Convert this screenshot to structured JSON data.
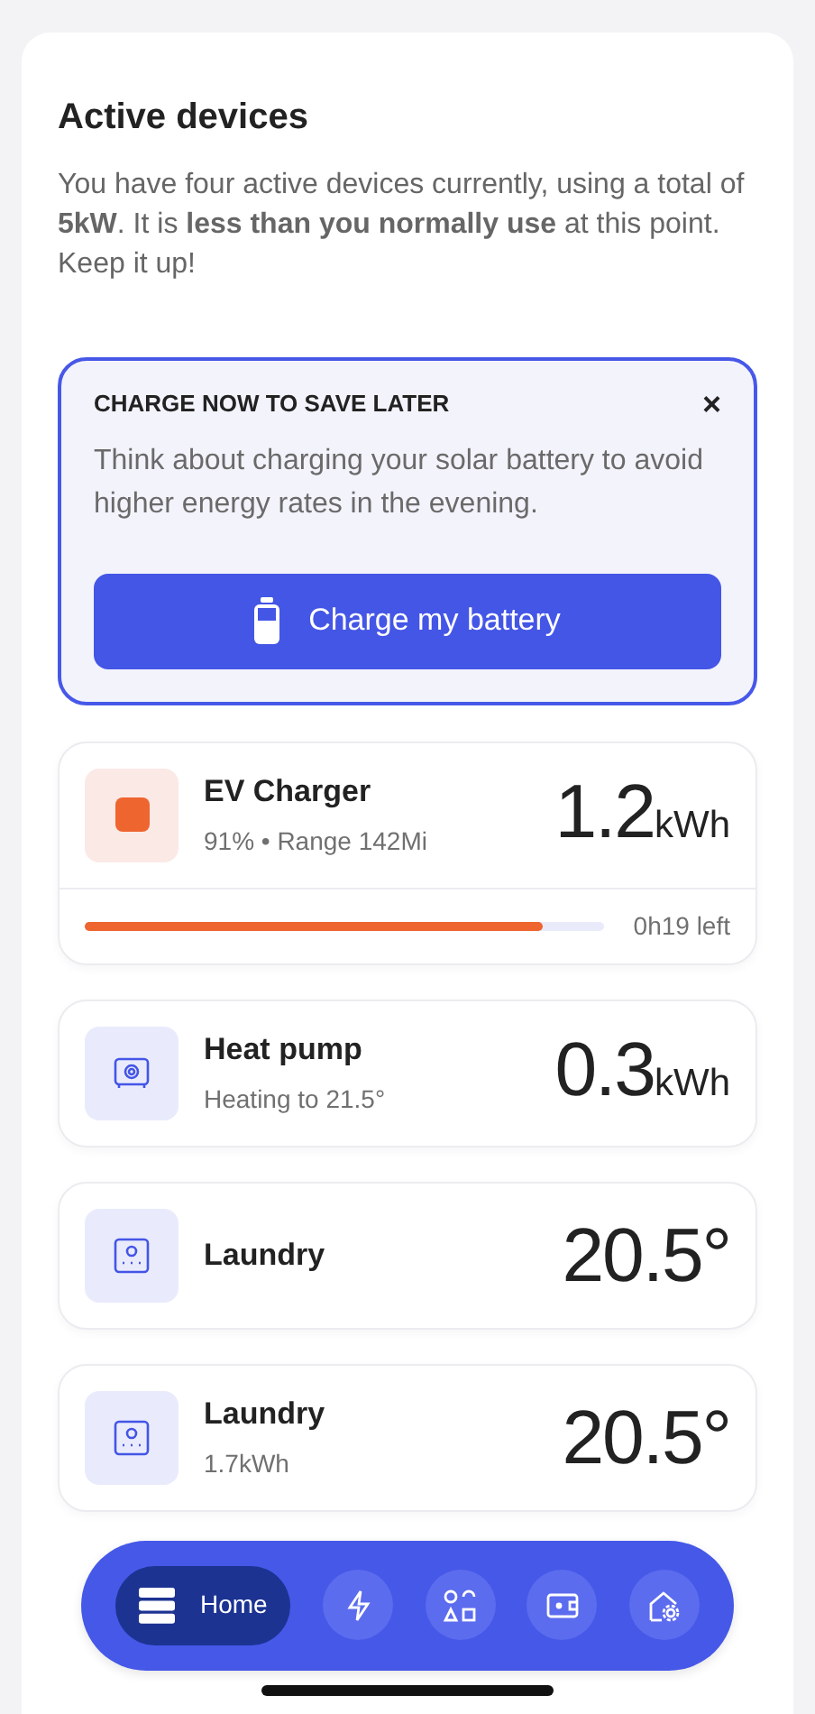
{
  "heading": "Active devices",
  "summary": "You have four active devices currently, using a total of **5kW**. It is **less than you normally use** at this point. Keep it up!",
  "banner": {
    "title": "CHARGE NOW TO SAVE LATER",
    "close": "×",
    "message": "Think about charging your solar battery to avoid higher energy rates in the evening.",
    "button": "Charge my battery"
  },
  "devices": [
    {
      "kind": "ev",
      "name": "EV Charger",
      "detail": "91% • Range 142Mi",
      "value": "1.2",
      "unit": "kWh",
      "level": 0.88,
      "remaining": "0h19 left"
    },
    {
      "kind": "heater",
      "name": "Heat pump",
      "detail": "Heating to 21.5°",
      "value": "0.3",
      "unit": "kWh"
    },
    {
      "kind": "laundry",
      "name": "Laundry",
      "value": "20.5°"
    },
    {
      "kind": "laundry",
      "name": "Laundry",
      "detail": "1.7kWh",
      "value": "20.5°"
    }
  ],
  "nav": [
    {
      "kind": "home",
      "label": "Home",
      "selected": true
    },
    {
      "kind": "energy",
      "selected": false
    },
    {
      "kind": "shapes",
      "selected": false
    },
    {
      "kind": "wallet",
      "selected": false
    },
    {
      "kind": "house",
      "selected": false
    }
  ]
}
